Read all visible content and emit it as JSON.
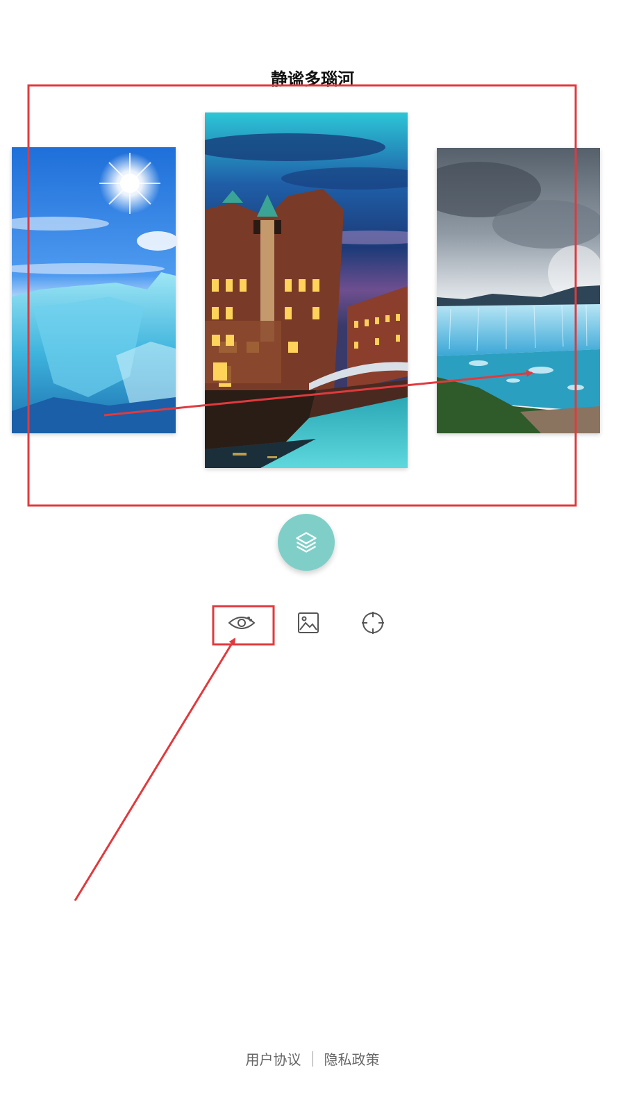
{
  "header": {
    "title": "静谧多瑙河"
  },
  "carousel": {
    "cards": [
      {
        "name": "glacier-ice-sun"
      },
      {
        "name": "speicherstadt-canal-night"
      },
      {
        "name": "glacier-lake-clouds"
      }
    ]
  },
  "actions": {
    "main_icon": "layers-icon",
    "tools": [
      "eye-icon",
      "image-icon",
      "crosshair-icon"
    ]
  },
  "footer": {
    "user_agreement": "用户协议",
    "privacy_policy": "隐私政策"
  },
  "colors": {
    "accent_teal": "#7fcfc8",
    "annotation_red": "#e03a3e",
    "icon_gray": "#555555"
  }
}
